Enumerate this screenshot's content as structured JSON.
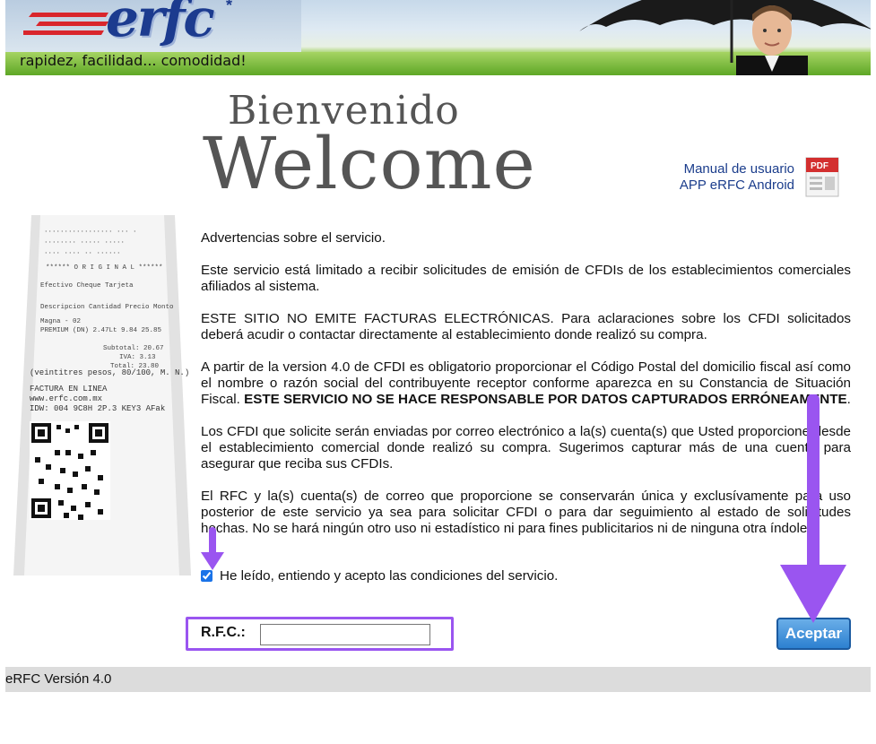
{
  "header": {
    "logo_text": "erfc",
    "tagline": "rapidez, facilidad... comodidad!"
  },
  "welcome": {
    "line1": "Bienvenido",
    "line2": "Welcome"
  },
  "links": {
    "manual": "Manual de usuario",
    "android": "APP eRFC Android",
    "pdf_icon_label": "PDF"
  },
  "receipt": {
    "lines": [
      "Descripcion  Cantidad Precio Monto",
      "Magna - 02",
      "PREMIUM (DN)    2.47Lt 9.84  25.85",
      "Subtotal:  20.67",
      "IVA:  3.13",
      "Total:  23.80",
      "(veintitres pesos, 80/100, M. N.)",
      "FACTURA EN LINEA",
      "www.erfc.com.mx",
      "IDW: 004 9C8H 2P.3 KEY3 AFak"
    ]
  },
  "content": {
    "p1": "Advertencias sobre el servicio.",
    "p2": "Este servicio está limitado a recibir solicitudes de emisión de CFDIs de los establecimientos comerciales afiliados al sistema.",
    "p3": "ESTE SITIO NO EMITE FACTURAS ELECTRÓNICAS. Para aclaraciones sobre los CFDI solicitados deberá acudir o contactar directamente al establecimiento donde realizó su compra.",
    "p4_normal": "A partir de la version 4.0 de CFDI es obligatorio proporcionar el Código Postal del domicilio fiscal así como el nombre o razón social del contribuyente receptor conforme aparezca en su Constancia de Situación Fiscal. ",
    "p4_bold": "ESTE SERVICIO NO SE HACE RESPONSABLE POR DATOS CAPTURADOS ERRÓNEAMENTE",
    "p4_end": ".",
    "p5": "Los CFDI que solicite serán enviadas por correo electrónico a la(s) cuenta(s) que Usted proporcione desde el establecimiento comercial donde realizó su compra. Sugerimos capturar más de una cuenta para asegurar que reciba sus CFDIs.",
    "p6": "El RFC y la(s) cuenta(s) de correo que proporcione se conservarán única y exclusívamente para uso posterior de este servicio ya sea para solicitar CFDI o para dar seguimiento al estado de solicitudes hechas. No se hará ningún otro uso ni estadístico ni para fines publicitarios ni de ninguna otra índole."
  },
  "form": {
    "accept_label": "He leído, entiendo y acepto las condiciones del servicio.",
    "accept_checked": true,
    "rfc_label": "R.F.C.:",
    "rfc_value": "",
    "submit_label": "Aceptar"
  },
  "footer": {
    "version": "eRFC Versión 4.0"
  },
  "colors": {
    "link": "#1b3d8c",
    "highlight": "#9a55f0",
    "button": "#2c80d0",
    "footer_bg": "#dcdcdc"
  }
}
